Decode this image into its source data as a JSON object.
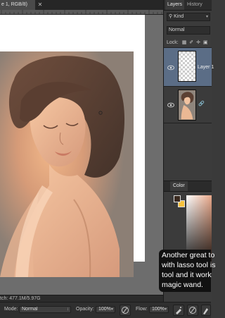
{
  "document": {
    "tab_title": "e 1, RGB/8)",
    "tab_close": "✕",
    "status_text": "tch: 477.1M/5.97G"
  },
  "layers_panel": {
    "tabs": [
      "Layers",
      "History"
    ],
    "kind_filter": "Kind",
    "blend_mode": "Normal",
    "lock_label": "Lock:",
    "layers": [
      {
        "name": "Layer 1",
        "selected": true,
        "transparent": true
      },
      {
        "name": "",
        "selected": false,
        "transparent": false
      }
    ]
  },
  "color_panel": {
    "tab": "Color",
    "foreground": "#3a2a20",
    "background": "#f7c23d"
  },
  "options_bar": {
    "mode_label": "Mode:",
    "mode_value": "Normal",
    "opacity_label": "Opacity:",
    "opacity_value": "100%",
    "flow_label": "Flow:",
    "flow_value": "100%"
  },
  "caption": {
    "lines": [
      "Another great to",
      "with lasso tool is",
      "tool and it work",
      "magic wand."
    ]
  },
  "colors": {
    "selected_layer": "#5b6d86",
    "panel_bg": "#3b3b3b",
    "canvas_bg": "#6d6d6d"
  },
  "icons": [
    "eye-icon",
    "brush-icon",
    "lock-icon",
    "pressure-icon",
    "airbrush-icon",
    "search-icon",
    "image-filter-icon",
    "link-icon"
  ]
}
